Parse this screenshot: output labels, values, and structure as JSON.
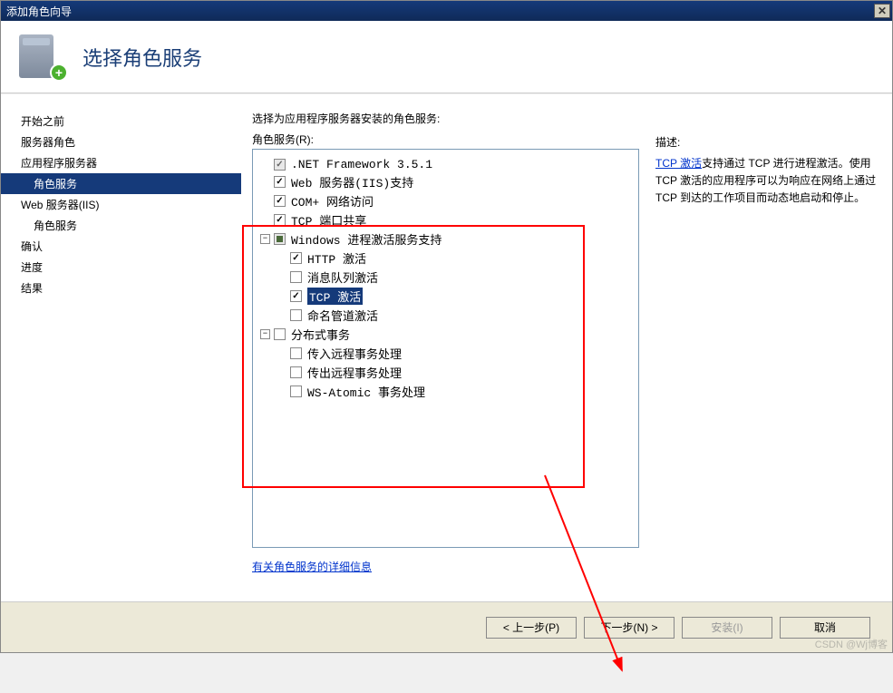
{
  "window": {
    "title": "添加角色向导"
  },
  "header": {
    "title": "选择角色服务"
  },
  "sidebar": {
    "items": [
      {
        "label": "开始之前",
        "indent": false,
        "selected": false
      },
      {
        "label": "服务器角色",
        "indent": false,
        "selected": false
      },
      {
        "label": "应用程序服务器",
        "indent": false,
        "selected": false
      },
      {
        "label": "角色服务",
        "indent": true,
        "selected": true
      },
      {
        "label": "Web 服务器(IIS)",
        "indent": false,
        "selected": false
      },
      {
        "label": "角色服务",
        "indent": true,
        "selected": false
      },
      {
        "label": "确认",
        "indent": false,
        "selected": false
      },
      {
        "label": "进度",
        "indent": false,
        "selected": false
      },
      {
        "label": "结果",
        "indent": false,
        "selected": false
      }
    ]
  },
  "main": {
    "prompt": "选择为应用程序服务器安装的角色服务:",
    "label_r": "角色服务(R):",
    "tree": [
      {
        "level": 0,
        "expander": "",
        "check": "checked-disabled",
        "label": ".NET Framework 3.5.1",
        "selected": false
      },
      {
        "level": 0,
        "expander": "",
        "check": "checked",
        "label": "Web 服务器(IIS)支持",
        "selected": false
      },
      {
        "level": 0,
        "expander": "",
        "check": "checked",
        "label": "COM+ 网络访问",
        "selected": false
      },
      {
        "level": 0,
        "expander": "",
        "check": "checked",
        "label": "TCP 端口共享",
        "selected": false
      },
      {
        "level": 0,
        "expander": "-",
        "check": "mixed",
        "label": "Windows 进程激活服务支持",
        "selected": false
      },
      {
        "level": 1,
        "expander": "",
        "check": "checked",
        "label": "HTTP 激活",
        "selected": false
      },
      {
        "level": 1,
        "expander": "",
        "check": "unchecked",
        "label": "消息队列激活",
        "selected": false
      },
      {
        "level": 1,
        "expander": "",
        "check": "checked",
        "label": "TCP 激活",
        "selected": true
      },
      {
        "level": 1,
        "expander": "",
        "check": "unchecked",
        "label": "命名管道激活",
        "selected": false
      },
      {
        "level": 0,
        "expander": "-",
        "check": "unchecked",
        "label": "分布式事务",
        "selected": false
      },
      {
        "level": 1,
        "expander": "",
        "check": "unchecked",
        "label": "传入远程事务处理",
        "selected": false
      },
      {
        "level": 1,
        "expander": "",
        "check": "unchecked",
        "label": "传出远程事务处理",
        "selected": false
      },
      {
        "level": 1,
        "expander": "",
        "check": "unchecked",
        "label": "WS-Atomic 事务处理",
        "selected": false
      }
    ],
    "more_info_link": "有关角色服务的详细信息"
  },
  "description": {
    "title": "描述:",
    "link_text": "TCP 激活",
    "body": "支持通过 TCP 进行进程激活。使用 TCP 激活的应用程序可以为响应在网络上通过 TCP 到达的工作项目而动态地启动和停止。"
  },
  "footer": {
    "prev": "< 上一步(P)",
    "next": "下一步(N) >",
    "install": "安装(I)",
    "cancel": "取消"
  },
  "watermark": "CSDN @Wj博客"
}
